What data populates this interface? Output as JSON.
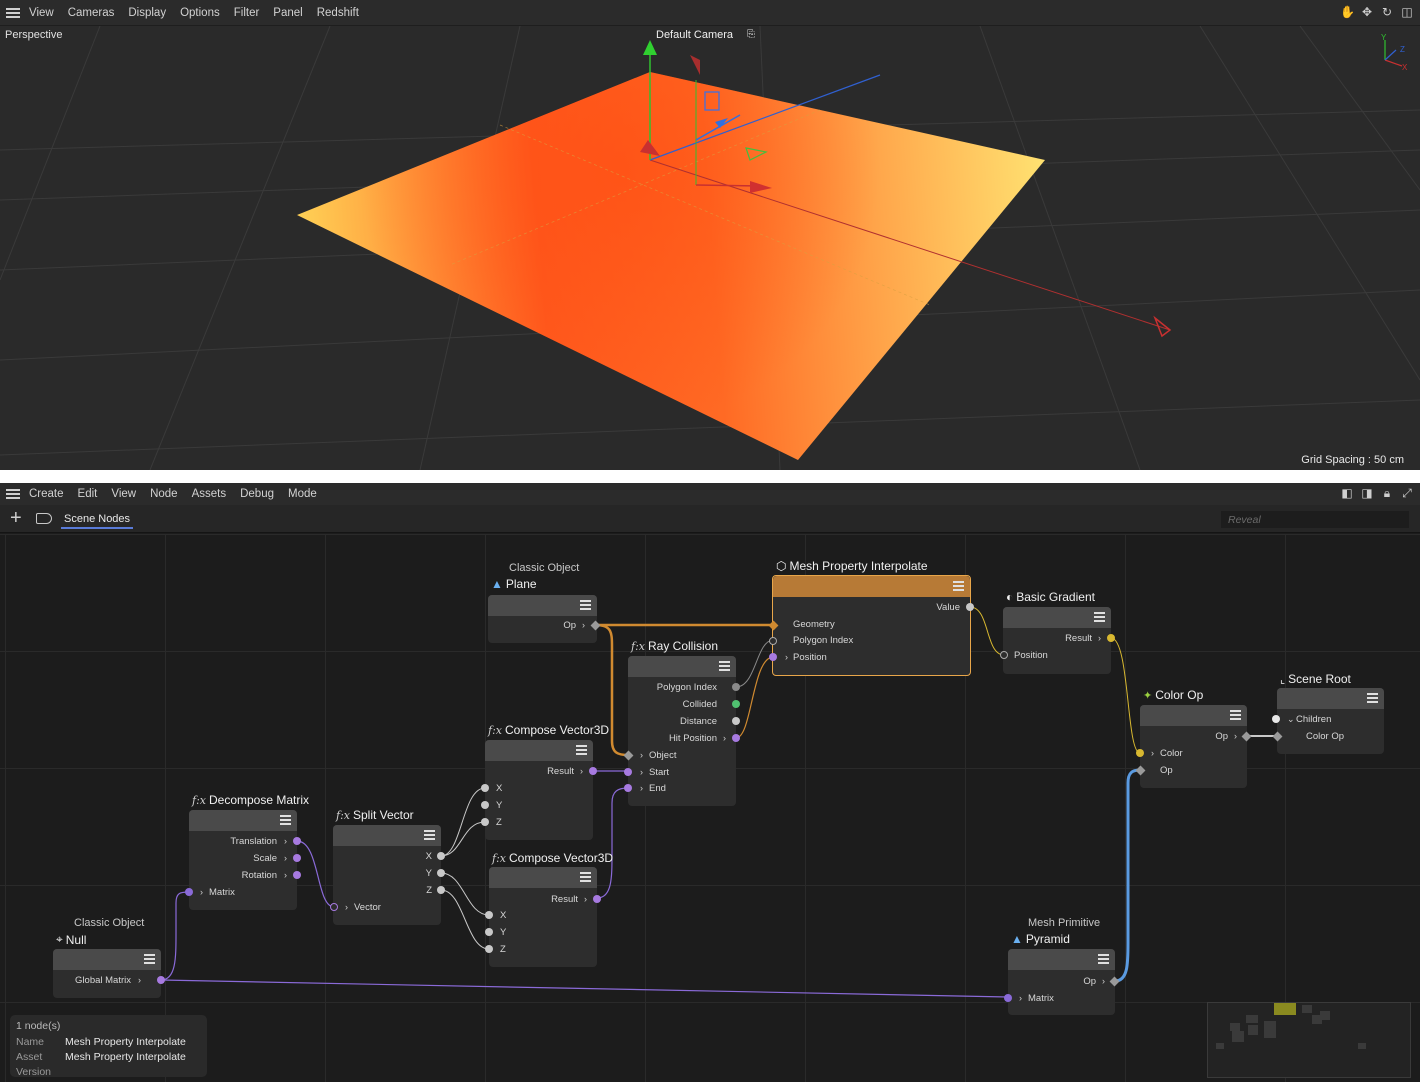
{
  "viewport": {
    "menu": [
      "View",
      "Cameras",
      "Display",
      "Options",
      "Filter",
      "Panel",
      "Redshift"
    ],
    "view_label": "Perspective",
    "camera_label": "Default Camera",
    "grid_spacing": "Grid Spacing : 50 cm",
    "axis_labels": {
      "x": "X",
      "y": "Y",
      "z": "Z"
    },
    "tools": [
      "hand-icon",
      "move-icon",
      "rotate-icon",
      "maximize-icon"
    ],
    "colors": {
      "background": "#2a2a2a",
      "plane_warm": "#ff5a1e",
      "plane_light": "#ffd055",
      "axis_x": "#c83030",
      "axis_y": "#30c830",
      "axis_z": "#3060d0"
    }
  },
  "node_editor": {
    "menu": [
      "Create",
      "Edit",
      "View",
      "Node",
      "Assets",
      "Debug",
      "Mode"
    ],
    "tab": "Scene Nodes",
    "search_placeholder": "Reveal",
    "nodes": {
      "plane": {
        "subtitle": "Classic Object",
        "title": "Plane",
        "ports": {
          "op": "Op"
        }
      },
      "mesh_prop": {
        "title": "Mesh Property Interpolate",
        "ports": {
          "value": "Value",
          "geometry": "Geometry",
          "polygon_index": "Polygon Index",
          "position": "Position"
        }
      },
      "basic_gradient": {
        "title": "Basic Gradient",
        "ports": {
          "result": "Result",
          "position": "Position"
        }
      },
      "ray_collision": {
        "title": "Ray Collision",
        "ports": {
          "polygon_index": "Polygon Index",
          "collided": "Collided",
          "distance": "Distance",
          "hit_position": "Hit Position",
          "object": "Object",
          "start": "Start",
          "end": "End"
        }
      },
      "compose1": {
        "title": "Compose Vector3D",
        "ports": {
          "result": "Result",
          "x": "X",
          "y": "Y",
          "z": "Z"
        }
      },
      "compose2": {
        "title": "Compose Vector3D",
        "ports": {
          "result": "Result",
          "x": "X",
          "y": "Y",
          "z": "Z"
        }
      },
      "decompose": {
        "title": "Decompose Matrix",
        "ports": {
          "translation": "Translation",
          "scale": "Scale",
          "rotation": "Rotation",
          "matrix": "Matrix"
        }
      },
      "split_vector": {
        "title": "Split Vector",
        "ports": {
          "x": "X",
          "y": "Y",
          "z": "Z",
          "vector": "Vector"
        }
      },
      "null": {
        "subtitle": "Classic Object",
        "title": "Null",
        "ports": {
          "global_matrix": "Global Matrix"
        }
      },
      "color_op": {
        "title": "Color Op",
        "ports": {
          "op_out": "Op",
          "color": "Color",
          "op_in": "Op"
        }
      },
      "scene_root": {
        "title": "Scene Root",
        "ports": {
          "children": "Children",
          "color_op": "Color Op"
        }
      },
      "pyramid": {
        "subtitle": "Mesh Primitive",
        "title": "Pyramid",
        "ports": {
          "op": "Op",
          "matrix": "Matrix"
        }
      }
    },
    "fx_label": "f:x",
    "status": {
      "count": "1 node(s)",
      "name_label": "Name",
      "name_value": "Mesh Property Interpolate",
      "asset_label": "Asset",
      "asset_value": "Mesh Property Interpolate",
      "version_label": "Version",
      "version_value": ""
    },
    "colors": {
      "selected_border": "#e8a64a",
      "wire_geometry": "#d08a30",
      "wire_vector": "#8a6ad8",
      "wire_color": "#d8b830",
      "wire_op": "#5a9ae0",
      "wire_data": "#c8c8c8",
      "tab_underline": "#5a7bd8"
    }
  }
}
